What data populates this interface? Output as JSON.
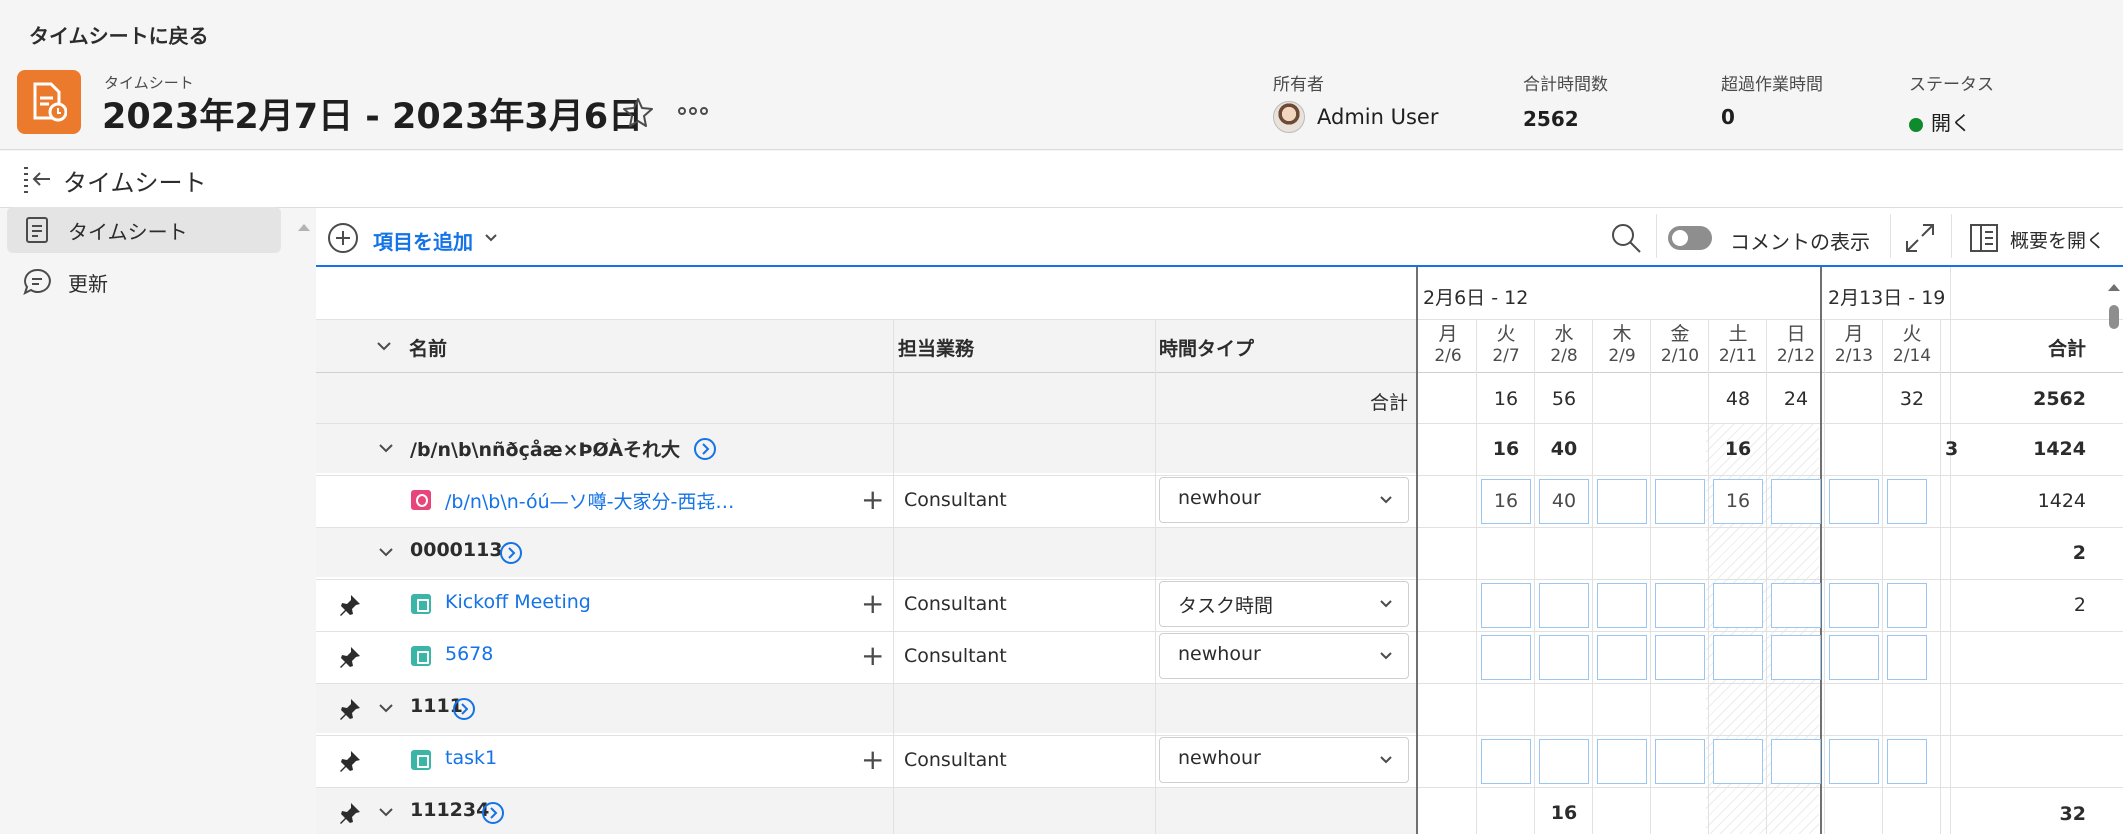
{
  "header": {
    "back_link": "タイムシートに戻る",
    "object_label": "タイムシート",
    "title": "2023年2月7日 - 2023年3月6日",
    "owner": {
      "label": "所有者",
      "value": "Admin User"
    },
    "total_hours": {
      "label": "合計時間数",
      "value": "2562"
    },
    "overtime": {
      "label": "超過作業時間",
      "value": "0"
    },
    "status": {
      "label": "ステータス",
      "value": "開く",
      "color": "#0f8a2c"
    },
    "accent_color": "#ec7a2c"
  },
  "subheader": {
    "title": "タイムシート"
  },
  "sidebar": {
    "items": [
      {
        "label": "タイムシート",
        "icon": "document-icon",
        "active": true
      },
      {
        "label": "更新",
        "icon": "comment-icon",
        "active": false
      }
    ]
  },
  "toolbar": {
    "add_label": "項目を追加",
    "comments_label": "コメントの表示",
    "overview_label": "概要を開く"
  },
  "grid": {
    "columns": {
      "name": "名前",
      "role": "担当業務",
      "hour_type": "時間タイプ",
      "total": "合計"
    },
    "weeks": [
      "2月6日 - 12",
      "2月13日 - 19"
    ],
    "days": [
      {
        "dow": "月",
        "date": "2/6"
      },
      {
        "dow": "火",
        "date": "2/7"
      },
      {
        "dow": "水",
        "date": "2/8"
      },
      {
        "dow": "木",
        "date": "2/9"
      },
      {
        "dow": "金",
        "date": "2/10"
      },
      {
        "dow": "土",
        "date": "2/11"
      },
      {
        "dow": "日",
        "date": "2/12"
      },
      {
        "dow": "月",
        "date": "2/13"
      },
      {
        "dow": "火",
        "date": "2/14"
      }
    ],
    "totals_row": {
      "label": "合計",
      "values": [
        "",
        "16",
        "56",
        "",
        "",
        "48",
        "24",
        "",
        "32"
      ],
      "total": "2562"
    },
    "rows": [
      {
        "type": "group",
        "name": "/b/n\\b\\nñðçåæ×ÞØÀそれ大",
        "values": [
          "",
          "16",
          "40",
          "",
          "",
          "16",
          "",
          "",
          ""
        ],
        "total": "1424"
      },
      {
        "type": "task",
        "kind": "request",
        "name": "/b/n\\b\\n-óú—ソ噂-大家分-西㐂…",
        "role": "Consultant",
        "hour_type": "newhour",
        "values": [
          "",
          "16",
          "40",
          "",
          "",
          "16",
          "",
          "",
          ""
        ],
        "total": "1424"
      },
      {
        "type": "group",
        "name": "0000113",
        "values": [],
        "total": "2"
      },
      {
        "type": "task",
        "kind": "task",
        "name": "Kickoff Meeting",
        "role": "Consultant",
        "hour_type": "タスク時間",
        "values": [],
        "total": "2"
      },
      {
        "type": "task",
        "kind": "task",
        "name": "5678",
        "role": "Consultant",
        "hour_type": "newhour",
        "values": [],
        "total": ""
      },
      {
        "type": "group",
        "name": "1111",
        "values": [],
        "total": ""
      },
      {
        "type": "task",
        "kind": "task",
        "name": "task1",
        "role": "Consultant",
        "hour_type": "newhour",
        "values": [],
        "total": ""
      },
      {
        "type": "group",
        "name": "111234",
        "values": [
          "",
          "",
          "16",
          "",
          "",
          "",
          "",
          "",
          ""
        ],
        "total": "32"
      }
    ]
  }
}
